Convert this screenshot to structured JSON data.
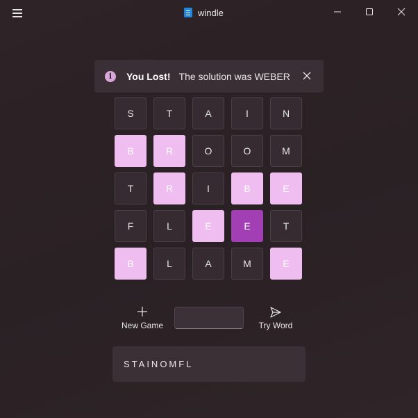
{
  "window": {
    "title": "windle"
  },
  "infobar": {
    "title": "You Lost!",
    "message": "The solution was WEBER"
  },
  "board": {
    "rows": [
      [
        {
          "letter": "S",
          "state": "absent"
        },
        {
          "letter": "T",
          "state": "absent"
        },
        {
          "letter": "A",
          "state": "absent"
        },
        {
          "letter": "I",
          "state": "absent"
        },
        {
          "letter": "N",
          "state": "absent"
        }
      ],
      [
        {
          "letter": "B",
          "state": "present"
        },
        {
          "letter": "R",
          "state": "present"
        },
        {
          "letter": "O",
          "state": "absent"
        },
        {
          "letter": "O",
          "state": "absent"
        },
        {
          "letter": "M",
          "state": "absent"
        }
      ],
      [
        {
          "letter": "T",
          "state": "absent"
        },
        {
          "letter": "R",
          "state": "present"
        },
        {
          "letter": "I",
          "state": "absent"
        },
        {
          "letter": "B",
          "state": "present"
        },
        {
          "letter": "E",
          "state": "present"
        }
      ],
      [
        {
          "letter": "F",
          "state": "absent"
        },
        {
          "letter": "L",
          "state": "absent"
        },
        {
          "letter": "E",
          "state": "present"
        },
        {
          "letter": "E",
          "state": "correct"
        },
        {
          "letter": "T",
          "state": "absent"
        }
      ],
      [
        {
          "letter": "B",
          "state": "present"
        },
        {
          "letter": "L",
          "state": "absent"
        },
        {
          "letter": "A",
          "state": "absent"
        },
        {
          "letter": "M",
          "state": "absent"
        },
        {
          "letter": "E",
          "state": "present"
        }
      ]
    ]
  },
  "controls": {
    "new_game_label": "New Game",
    "try_word_label": "Try Word",
    "guess_value": ""
  },
  "used_letters": "STAINOMFL",
  "colors": {
    "present": "#efbdef",
    "correct": "#a33fb5",
    "accent_icon": "#1f87e0"
  }
}
